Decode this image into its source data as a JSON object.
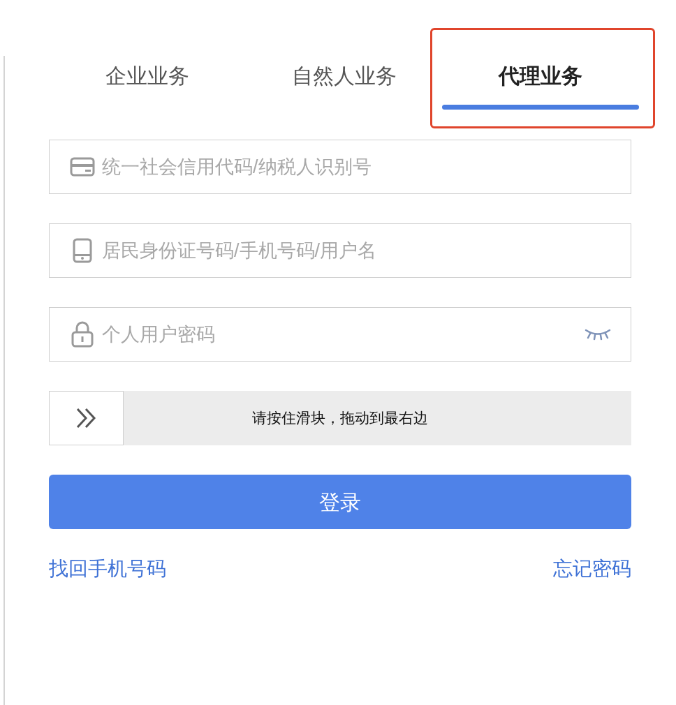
{
  "tabs": [
    {
      "label": "企业业务",
      "selected": false,
      "annotated": false
    },
    {
      "label": "自然人业务",
      "selected": false,
      "annotated": false
    },
    {
      "label": "代理业务",
      "selected": true,
      "annotated": true
    }
  ],
  "fields": [
    {
      "kind": "card",
      "placeholder": "统一社会信用代码/纳税人识别号"
    },
    {
      "kind": "phone",
      "placeholder": "居民身份证号码/手机号码/用户名"
    },
    {
      "kind": "password",
      "placeholder": "个人用户密码",
      "password_visible": false
    }
  ],
  "slider": {
    "label": "请按住滑块，拖动到最右边",
    "level": 0
  },
  "login_button": "登录",
  "links": [
    "找回手机号码",
    "忘记密码"
  ]
}
